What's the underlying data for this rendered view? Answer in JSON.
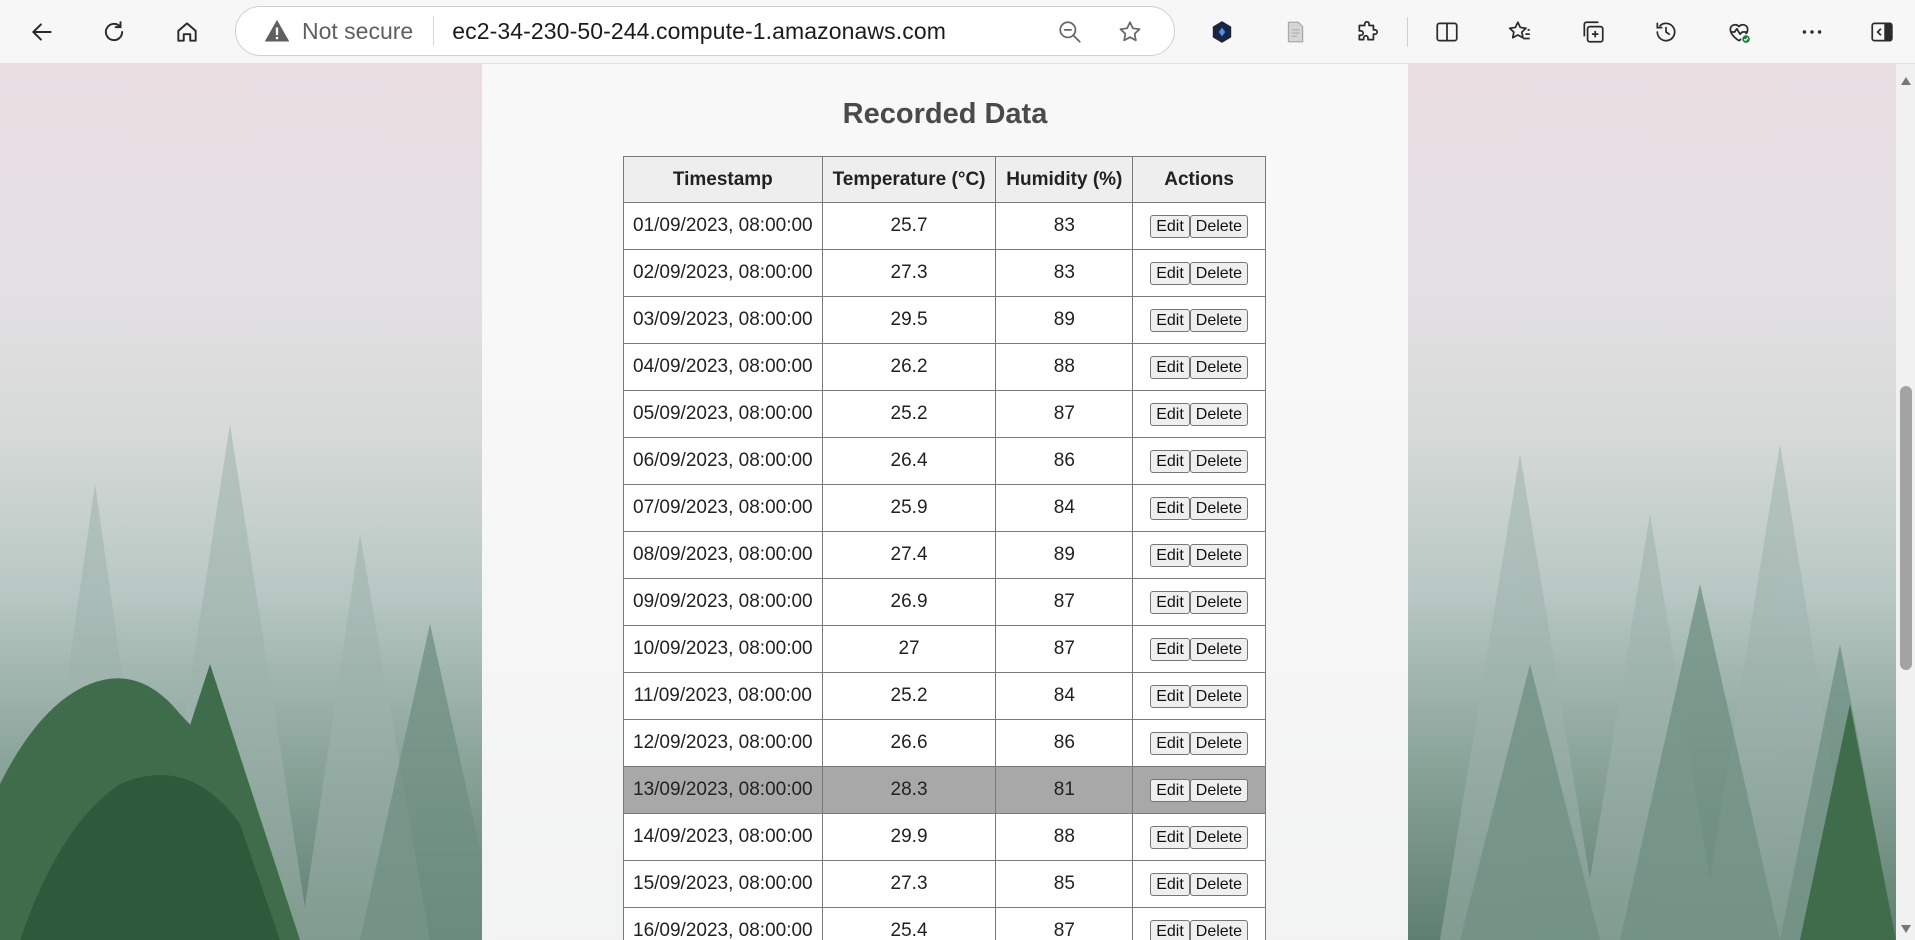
{
  "browser": {
    "security_label": "Not secure",
    "url": "ec2-34-230-50-244.compute-1.amazonaws.com"
  },
  "page": {
    "section_title": "Recorded Data",
    "columns": [
      "Timestamp",
      "Temperature (°C)",
      "Humidity (%)",
      "Actions"
    ],
    "action_labels": {
      "edit": "Edit",
      "delete": "Delete"
    },
    "selected_row_index": 12,
    "rows": [
      {
        "timestamp": "01/09/2023, 08:00:00",
        "temperature": "25.7",
        "humidity": "83"
      },
      {
        "timestamp": "02/09/2023, 08:00:00",
        "temperature": "27.3",
        "humidity": "83"
      },
      {
        "timestamp": "03/09/2023, 08:00:00",
        "temperature": "29.5",
        "humidity": "89"
      },
      {
        "timestamp": "04/09/2023, 08:00:00",
        "temperature": "26.2",
        "humidity": "88"
      },
      {
        "timestamp": "05/09/2023, 08:00:00",
        "temperature": "25.2",
        "humidity": "87"
      },
      {
        "timestamp": "06/09/2023, 08:00:00",
        "temperature": "26.4",
        "humidity": "86"
      },
      {
        "timestamp": "07/09/2023, 08:00:00",
        "temperature": "25.9",
        "humidity": "84"
      },
      {
        "timestamp": "08/09/2023, 08:00:00",
        "temperature": "27.4",
        "humidity": "89"
      },
      {
        "timestamp": "09/09/2023, 08:00:00",
        "temperature": "26.9",
        "humidity": "87"
      },
      {
        "timestamp": "10/09/2023, 08:00:00",
        "temperature": "27",
        "humidity": "87"
      },
      {
        "timestamp": "11/09/2023, 08:00:00",
        "temperature": "25.2",
        "humidity": "84"
      },
      {
        "timestamp": "12/09/2023, 08:00:00",
        "temperature": "26.6",
        "humidity": "86"
      },
      {
        "timestamp": "13/09/2023, 08:00:00",
        "temperature": "28.3",
        "humidity": "81"
      },
      {
        "timestamp": "14/09/2023, 08:00:00",
        "temperature": "29.9",
        "humidity": "88"
      },
      {
        "timestamp": "15/09/2023, 08:00:00",
        "temperature": "27.3",
        "humidity": "85"
      },
      {
        "timestamp": "16/09/2023, 08:00:00",
        "temperature": "25.4",
        "humidity": "87"
      }
    ]
  },
  "colors": {
    "selected_row": "#a8a8a8",
    "header_bg": "#eeeeee",
    "title_text": "#4a4a4a",
    "warning_icon": "#5f5f5f"
  },
  "icons": [
    "back-icon",
    "refresh-icon",
    "home-icon",
    "warning-icon",
    "zoom-out-icon",
    "favorite-icon",
    "extension-badge-icon",
    "reading-view-icon",
    "extensions-icon",
    "split-screen-icon",
    "favorites-icon",
    "collections-icon",
    "history-icon",
    "browser-essentials-icon",
    "more-icon",
    "sidebar-icon"
  ]
}
